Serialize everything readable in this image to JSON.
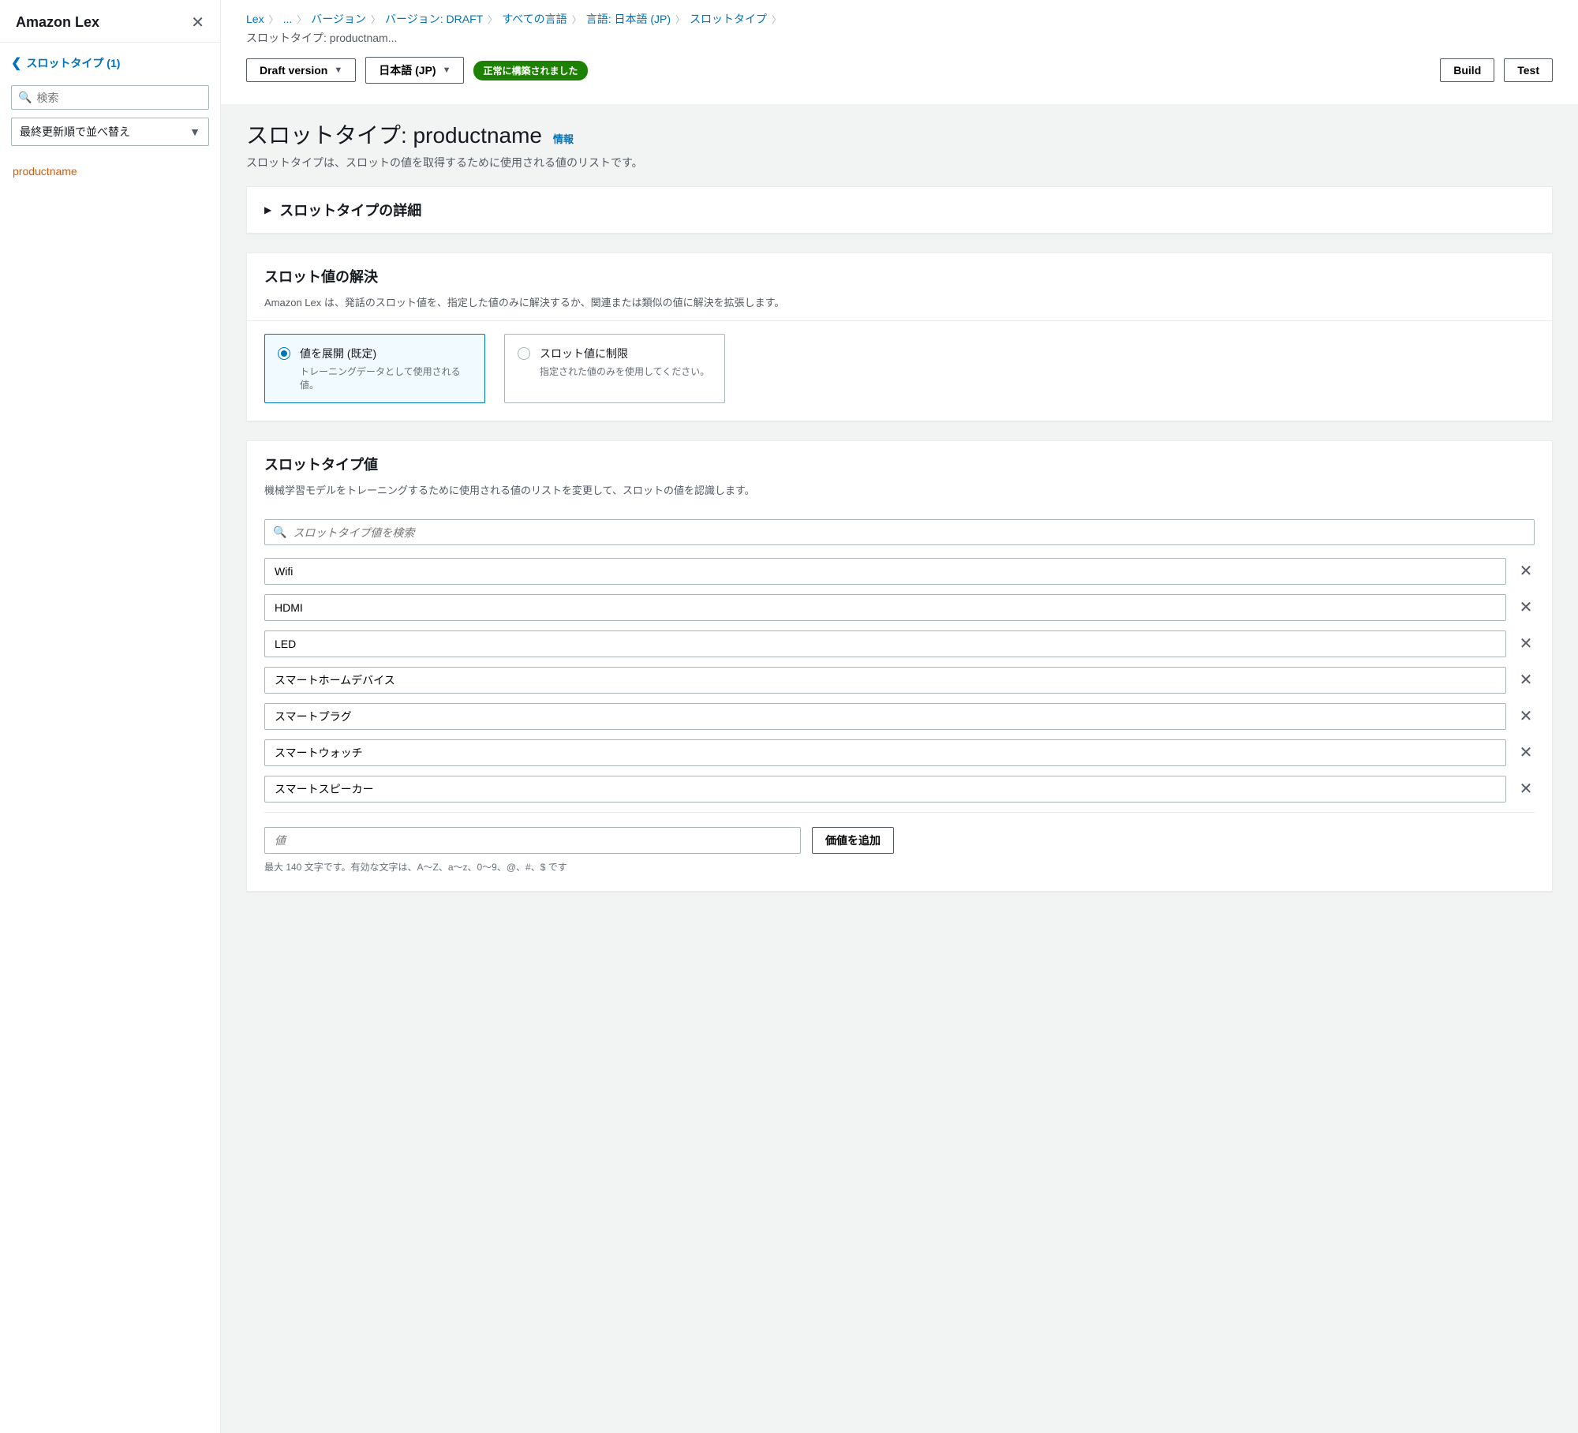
{
  "sidebar": {
    "title": "Amazon Lex",
    "back_label": "スロットタイプ (1)",
    "search_placeholder": "検索",
    "sort_label": "最終更新順で並べ替え",
    "items": [
      {
        "label": "productname"
      }
    ]
  },
  "breadcrumbs": [
    "Lex",
    "...",
    "バージョン",
    "バージョン: DRAFT",
    "すべての言語",
    "言語: 日本語 (JP)",
    "スロットタイプ"
  ],
  "breadcrumb_current": "スロットタイプ: productnam...",
  "actions": {
    "draft_version": "Draft version",
    "language": "日本語 (JP)",
    "status_badge": "正常に構築されました",
    "build": "Build",
    "test": "Test"
  },
  "page": {
    "title": "スロットタイプ: productname",
    "info": "情報",
    "desc": "スロットタイプは、スロットの値を取得するために使用される値のリストです。"
  },
  "details_panel": {
    "title": "スロットタイプの詳細"
  },
  "resolution": {
    "title": "スロット値の解決",
    "desc": "Amazon Lex は、発話のスロット値を、指定した値のみに解決するか、関連または類似の値に解決を拡張します。",
    "opt1_label": "値を展開 (既定)",
    "opt1_desc": "トレーニングデータとして使用される値。",
    "opt2_label": "スロット値に制限",
    "opt2_desc": "指定された値のみを使用してください。"
  },
  "values": {
    "title": "スロットタイプ値",
    "desc": "機械学習モデルをトレーニングするために使用される値のリストを変更して、スロットの値を認識します。",
    "search_placeholder": "スロットタイプ値を検索",
    "items": [
      "Wifi",
      "HDMI",
      "LED",
      "スマートホームデバイス",
      "スマートプラグ",
      "スマートウォッチ",
      "スマートスピーカー"
    ],
    "add_placeholder": "値",
    "add_button": "価値を追加",
    "hint": "最大 140 文字です。有効な文字は、A～Z、a～z、0～9、@、#、$ です"
  }
}
